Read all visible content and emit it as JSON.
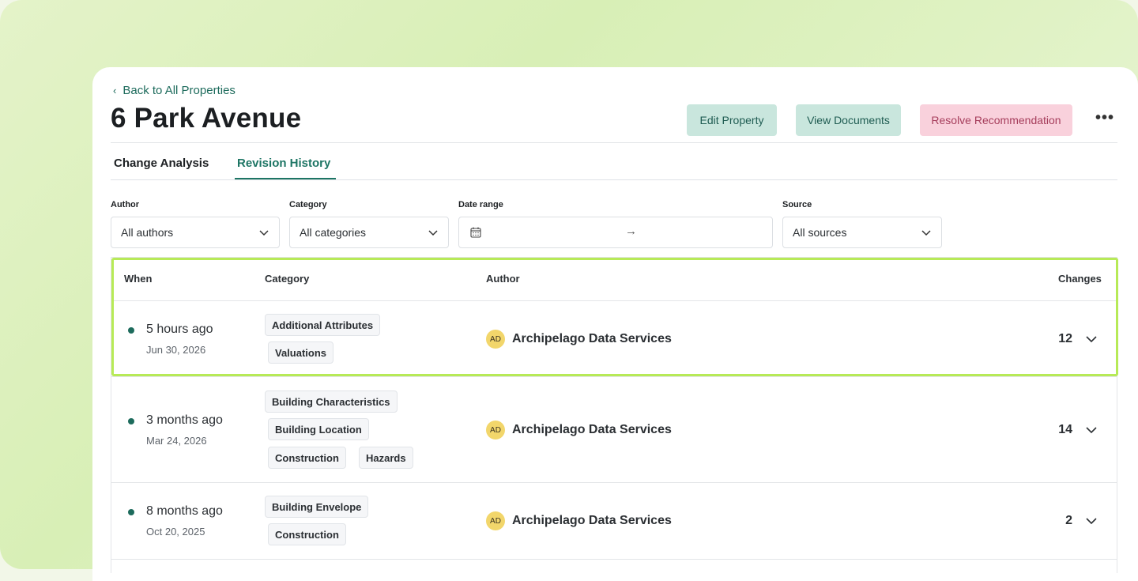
{
  "header": {
    "back_label": "Back to All Properties",
    "title": "6 Park Avenue",
    "actions": {
      "edit": "Edit Property",
      "docs": "View Documents",
      "resolve": "Resolve Recommendation",
      "more": "•••"
    }
  },
  "tabs": [
    {
      "label": "Change Analysis",
      "active": false
    },
    {
      "label": "Revision History",
      "active": true
    }
  ],
  "filters": {
    "author": {
      "label": "Author",
      "value": "All authors"
    },
    "category": {
      "label": "Category",
      "value": "All categories"
    },
    "date_range": {
      "label": "Date range",
      "arrow": "→"
    },
    "source": {
      "label": "Source",
      "value": "All sources"
    }
  },
  "table": {
    "columns": {
      "when": "When",
      "category": "Category",
      "author": "Author",
      "changes": "Changes"
    },
    "rows": [
      {
        "when": "5 hours ago",
        "date": "Jun 30, 2026",
        "categories": [
          "Additional Attributes",
          "Valuations"
        ],
        "avatar": "AD",
        "author": "Archipelago Data Services",
        "changes": "12"
      },
      {
        "when": "3 months ago",
        "date": "Mar 24, 2026",
        "categories": [
          "Building Characteristics",
          "Building Location",
          "Construction",
          "Hazards"
        ],
        "avatar": "AD",
        "author": "Archipelago Data Services",
        "changes": "14"
      },
      {
        "when": "8 months ago",
        "date": "Oct 20, 2025",
        "categories": [
          "Building Envelope",
          "Construction"
        ],
        "avatar": "AD",
        "author": "Archipelago Data Services",
        "changes": "2"
      }
    ]
  },
  "colors": {
    "accent": "#1d7564",
    "highlight": "#b7ea57",
    "resolve_bg": "#f9d1dc",
    "secondary_bg": "#c9e6dd",
    "avatar": "#f2d66b"
  }
}
